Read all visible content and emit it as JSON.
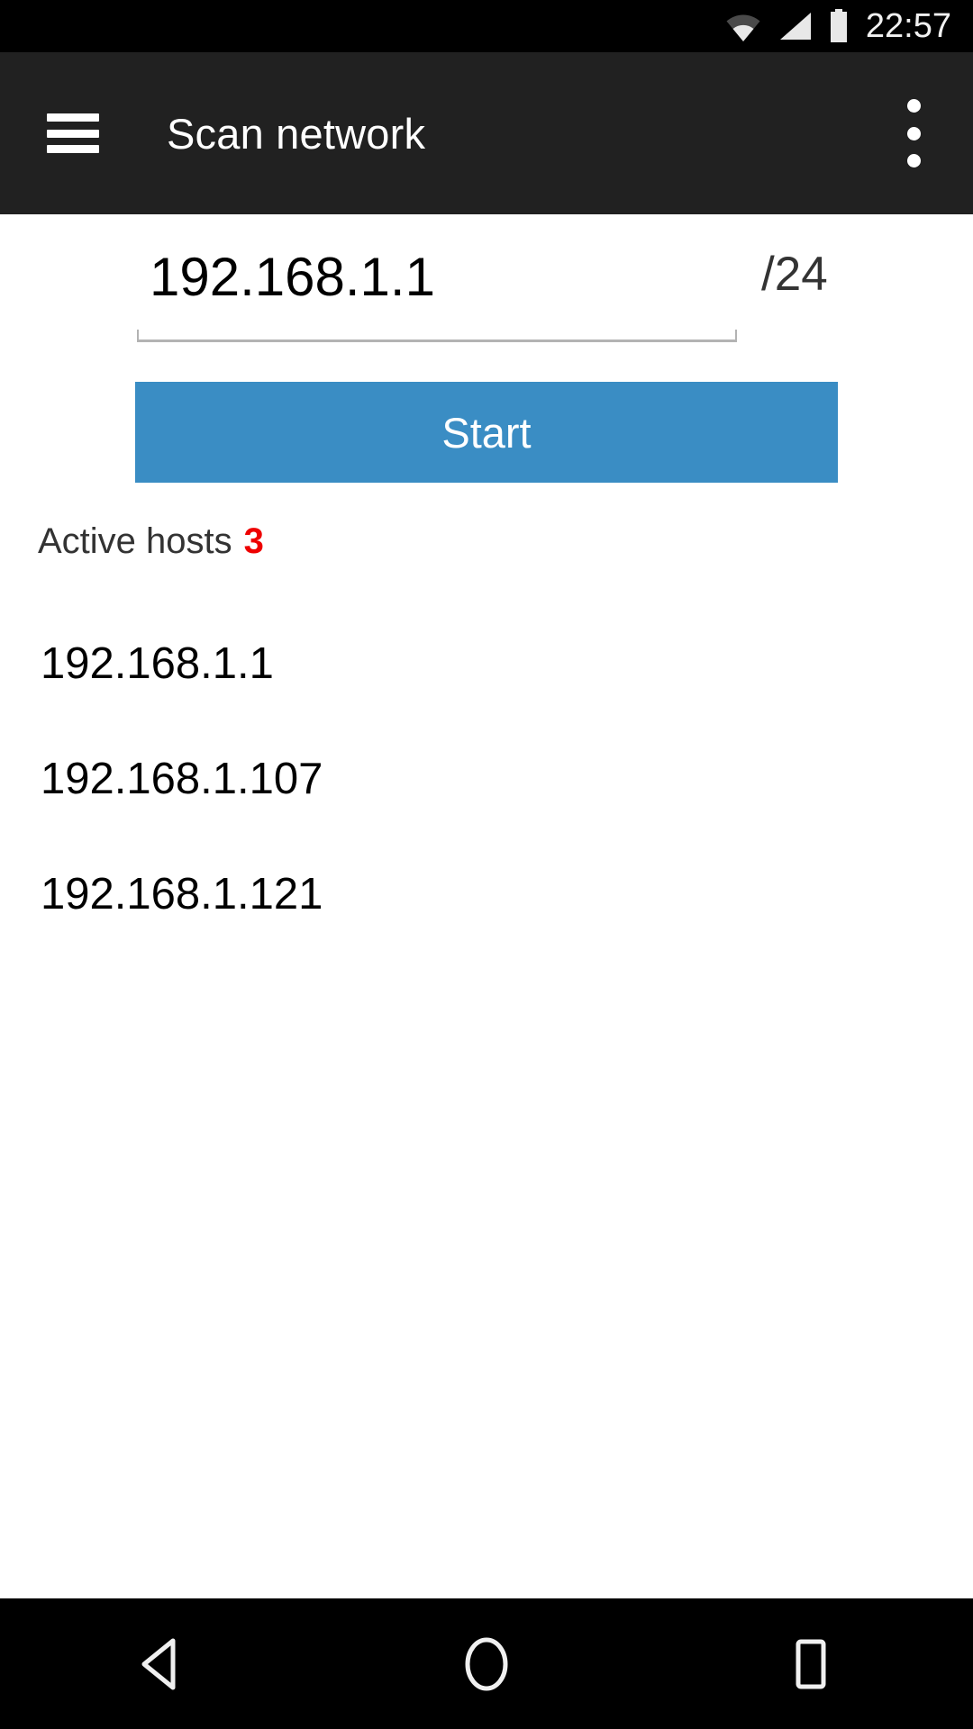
{
  "status_bar": {
    "clock": "22:57",
    "icons": [
      "wifi-icon",
      "cellular-signal-icon",
      "battery-icon"
    ],
    "background": "#000000",
    "foreground": "#f1f1f1"
  },
  "toolbar": {
    "title": "Scan network",
    "menu_icon": "hamburger-menu-icon",
    "overflow_icon": "overflow-menu-icon",
    "background": "#212121",
    "text_color": "#ffffff"
  },
  "form": {
    "ip_value": "192.168.1.1",
    "ip_placeholder": "192.168.1.1",
    "cidr_suffix": "/24",
    "start_label": "Start",
    "start_color": "#3a8dc4"
  },
  "results": {
    "active_hosts_label": "Active hosts",
    "active_hosts_count": "3",
    "count_color": "#ee0000",
    "hosts": [
      {
        "ip": "192.168.1.1"
      },
      {
        "ip": "192.168.1.107"
      },
      {
        "ip": "192.168.1.121"
      }
    ]
  },
  "nav_bar": {
    "back_label": "back-icon",
    "home_label": "home-icon",
    "recents_label": "recents-icon",
    "background": "#000000"
  }
}
